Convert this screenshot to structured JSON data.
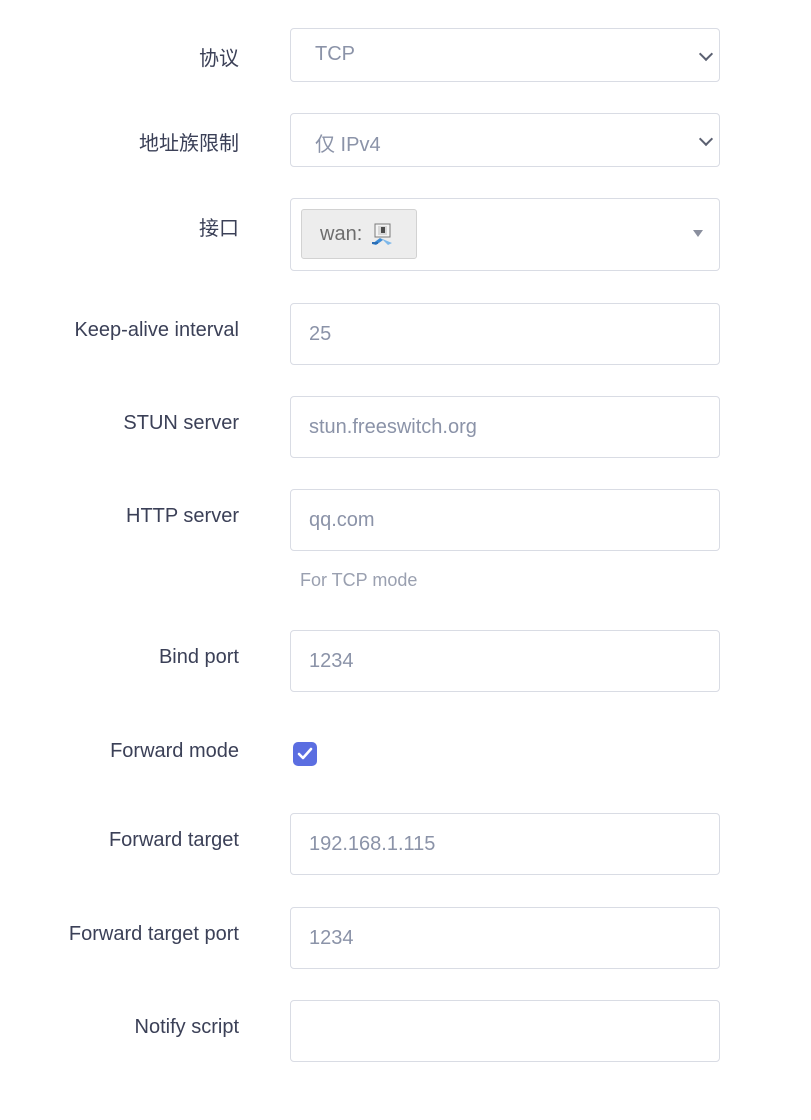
{
  "form": {
    "protocol": {
      "label": "协议",
      "value": "TCP"
    },
    "family": {
      "label": "地址族限制",
      "value": "仅 IPv4"
    },
    "interface": {
      "label": "接口",
      "tag": "wan:",
      "icon": "network-interface-icon"
    },
    "keepalive": {
      "label": "Keep-alive interval",
      "value": "25"
    },
    "stun": {
      "label": "STUN server",
      "value": "stun.freeswitch.org"
    },
    "http": {
      "label": "HTTP server",
      "value": "qq.com",
      "hint": "For TCP mode"
    },
    "bind_port": {
      "label": "Bind port",
      "value": "1234"
    },
    "forward_mode": {
      "label": "Forward mode",
      "checked": true
    },
    "forward_target": {
      "label": "Forward target",
      "value": "192.168.1.115"
    },
    "forward_target_port": {
      "label": "Forward target port",
      "value": "1234"
    },
    "notify_script": {
      "label": "Notify script",
      "value": ""
    }
  },
  "colors": {
    "accent": "#5b6ee1",
    "label": "#3b4057",
    "placeholder": "#8b93a8",
    "border": "#d9dce4"
  }
}
